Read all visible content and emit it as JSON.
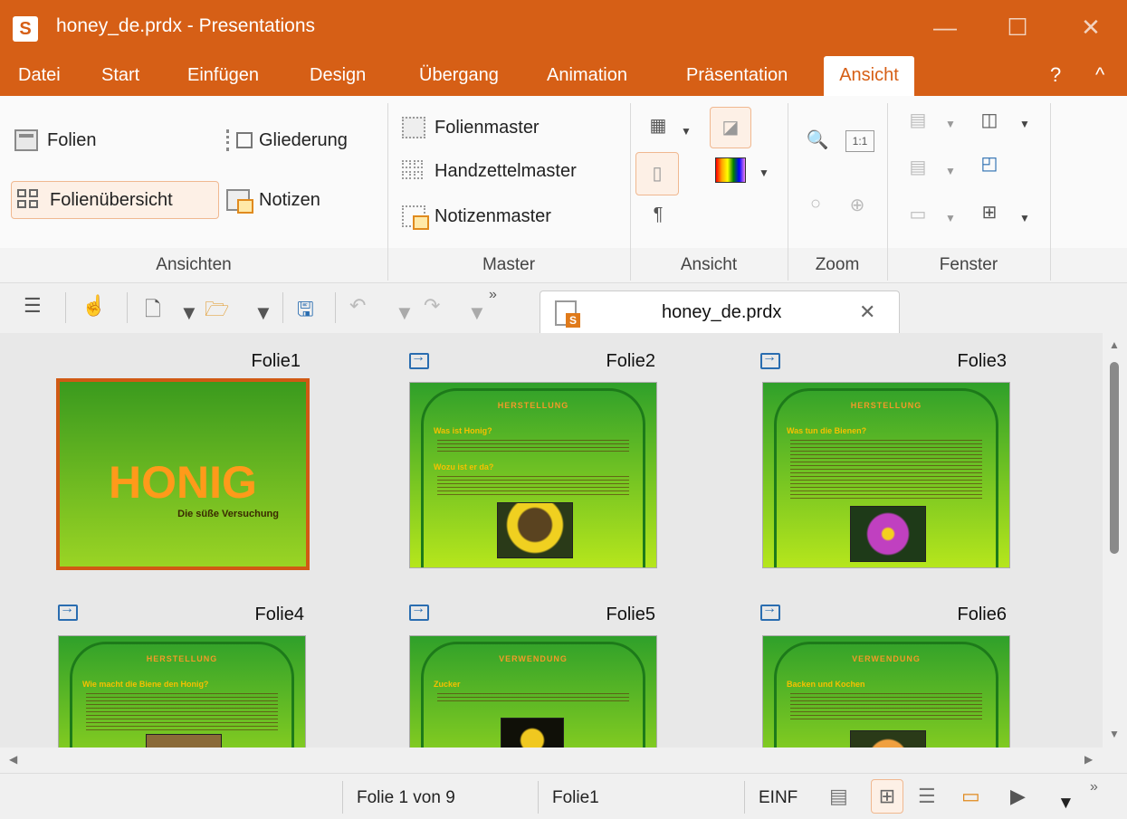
{
  "window": {
    "app_icon": "S",
    "title": "honey_de.prdx - Presentations",
    "minimize_icon": "—",
    "maximize_icon": "☐",
    "close_icon": "✕"
  },
  "menu": {
    "items": [
      "Datei",
      "Start",
      "Einfügen",
      "Design",
      "Übergang",
      "Animation",
      "Präsentation",
      "Ansicht"
    ],
    "active": "Ansicht",
    "help": "?",
    "collapse": "^"
  },
  "ribbon": {
    "ansichten": {
      "label": "Ansichten",
      "folien": "Folien",
      "gliederung": "Gliederung",
      "folienuebersicht": "Folienübersicht",
      "notizen": "Notizen"
    },
    "master": {
      "label": "Master",
      "folienmaster": "Folienmaster",
      "handzettelmaster": "Handzettelmaster",
      "notizenmaster": "Notizenmaster"
    },
    "ansicht": {
      "label": "Ansicht",
      "pilcrow": "¶"
    },
    "zoom": {
      "label": "Zoom",
      "one_to_one": "1:1"
    },
    "fenster": {
      "label": "Fenster"
    }
  },
  "quick_access": {
    "more": "»"
  },
  "document_tab": {
    "name": "honey_de.prdx",
    "close": "✕"
  },
  "slides": [
    {
      "label": "Folie1",
      "title": "HONIG",
      "subtitle": "Die süße Versuchung",
      "selected": true
    },
    {
      "label": "Folie2",
      "heading": "HERSTELLUNG",
      "bullets": [
        "Was ist Honig?",
        "Wozu ist er da?"
      ]
    },
    {
      "label": "Folie3",
      "heading": "HERSTELLUNG",
      "bullets": [
        "Was tun die Bienen?"
      ]
    },
    {
      "label": "Folie4",
      "heading": "HERSTELLUNG",
      "bullets": [
        "Wie macht die Biene den Honig?"
      ]
    },
    {
      "label": "Folie5",
      "heading": "VERWENDUNG",
      "bullets": [
        "Zucker"
      ]
    },
    {
      "label": "Folie6",
      "heading": "VERWENDUNG",
      "bullets": [
        "Backen und Kochen"
      ]
    }
  ],
  "status": {
    "slide_position": "Folie 1 von 9",
    "slide_name": "Folie1",
    "mode": "EINF",
    "more": "»"
  },
  "colors": {
    "accent": "#d65f16",
    "slide_green": "#2fa02a",
    "slide_orange": "#ff9a1a"
  }
}
